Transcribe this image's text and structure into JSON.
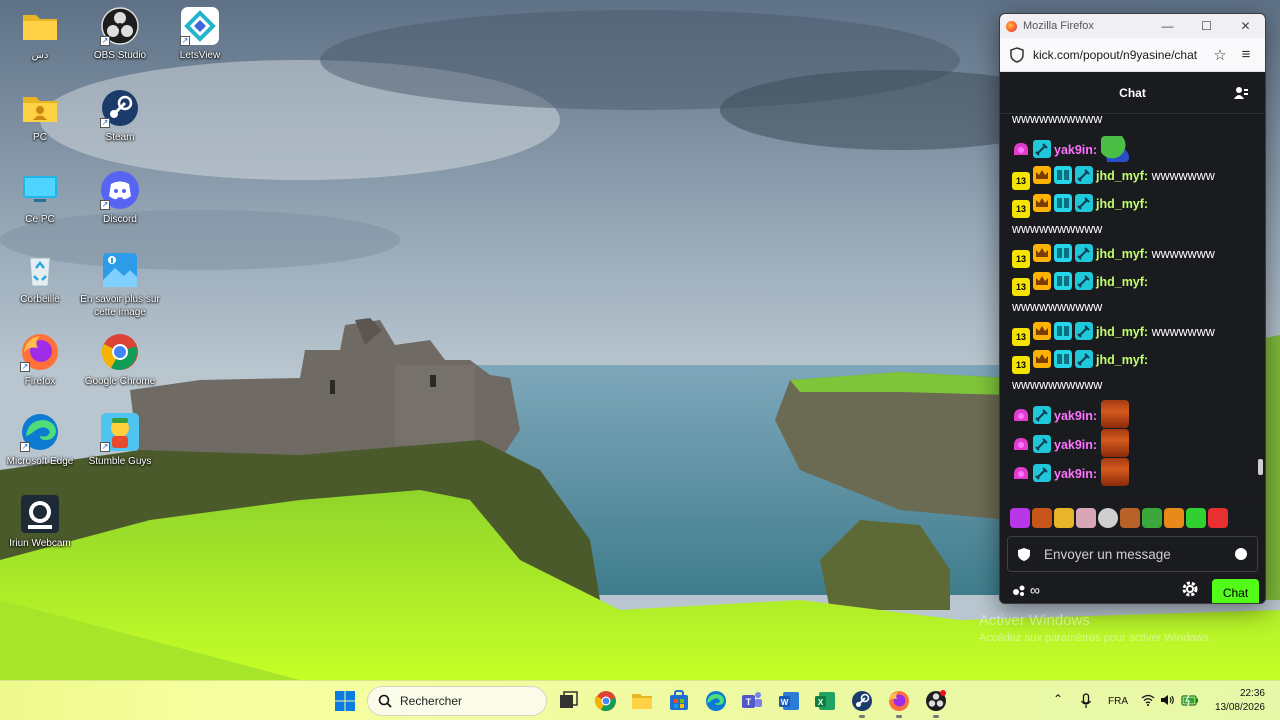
{
  "desktop": {
    "icons": [
      {
        "label": "دس",
        "icon": "folder-icon"
      },
      {
        "label": "OBS Studio",
        "icon": "obs-icon"
      },
      {
        "label": "LetsView",
        "icon": "letsview-icon"
      },
      {
        "label": "PC",
        "icon": "user-folder-icon"
      },
      {
        "label": "Steam",
        "icon": "steam-icon"
      },
      {
        "label": "Ce PC",
        "icon": "computer-icon"
      },
      {
        "label": "Discord",
        "icon": "discord-icon"
      },
      {
        "label": "Corbeille",
        "icon": "recycle-bin-icon"
      },
      {
        "label": "En savoir plus sur cette image",
        "icon": "spotlight-info-icon"
      },
      {
        "label": "Firefox",
        "icon": "firefox-icon"
      },
      {
        "label": "Google Chrome",
        "icon": "chrome-icon"
      },
      {
        "label": "Microsoft Edge",
        "icon": "edge-icon"
      },
      {
        "label": "Stumble Guys",
        "icon": "stumble-guys-icon"
      },
      {
        "label": "Iriun Webcam",
        "icon": "iriun-webcam-icon"
      }
    ]
  },
  "browser": {
    "window_title": "Mozilla Firefox",
    "url": "kick.com/popout/n9yasine/chat",
    "controls": {
      "minimize": "—",
      "maximize": "☐",
      "close": "✕"
    }
  },
  "chat": {
    "header_title": "Chat",
    "partial_first_line": "wwwwwwwwww",
    "messages": [
      {
        "badges": [
          "sub-pink",
          "moderator"
        ],
        "username": "yak9in:",
        "user_color": "pink",
        "text": "",
        "emote": "pepe-emote"
      },
      {
        "badges": [
          "13",
          "crown",
          "og",
          "moderator"
        ],
        "username": "jhd_myf:",
        "user_color": "green",
        "text": "wwwwwww"
      },
      {
        "badges": [
          "13",
          "crown",
          "og",
          "moderator"
        ],
        "username": "jhd_myf:",
        "user_color": "green",
        "text": "wwwwwwwwww"
      },
      {
        "badges": [
          "13",
          "crown",
          "og",
          "moderator"
        ],
        "username": "jhd_myf:",
        "user_color": "green",
        "text": "wwwwwww"
      },
      {
        "badges": [
          "13",
          "crown",
          "og",
          "moderator"
        ],
        "username": "jhd_myf:",
        "user_color": "green",
        "text": "wwwwwwwwww"
      },
      {
        "badges": [
          "13",
          "crown",
          "og",
          "moderator"
        ],
        "username": "jhd_myf:",
        "user_color": "green",
        "text": "wwwwwww"
      },
      {
        "badges": [
          "13",
          "crown",
          "og",
          "moderator"
        ],
        "username": "jhd_myf:",
        "user_color": "green",
        "text": "wwwwwwwwww"
      },
      {
        "badges": [
          "sub-pink",
          "moderator"
        ],
        "username": "yak9in:",
        "user_color": "pink",
        "text": "",
        "emote": "face-emote"
      },
      {
        "badges": [
          "sub-pink",
          "moderator"
        ],
        "username": "yak9in:",
        "user_color": "pink",
        "text": "",
        "emote": "face-emote"
      },
      {
        "badges": [
          "sub-pink",
          "moderator"
        ],
        "username": "yak9in:",
        "user_color": "pink",
        "text": "",
        "emote": "face-emote"
      }
    ],
    "sub_badge_number": "13",
    "input_placeholder": "Envoyer un message",
    "points": "∞",
    "send_label": "Chat"
  },
  "watermark": {
    "line1": "Activer Windows",
    "line2": "Accédez aux paramètres pour activer Windows."
  },
  "taskbar": {
    "search_placeholder": "Rechercher",
    "language": "FRA",
    "time": "22:36",
    "date": "13/08/2026"
  },
  "colors": {
    "kick_green": "#53fc18",
    "chat_bg": "#191b1f",
    "username_pink": "#ff73ff",
    "username_green": "#c3ff6b"
  }
}
